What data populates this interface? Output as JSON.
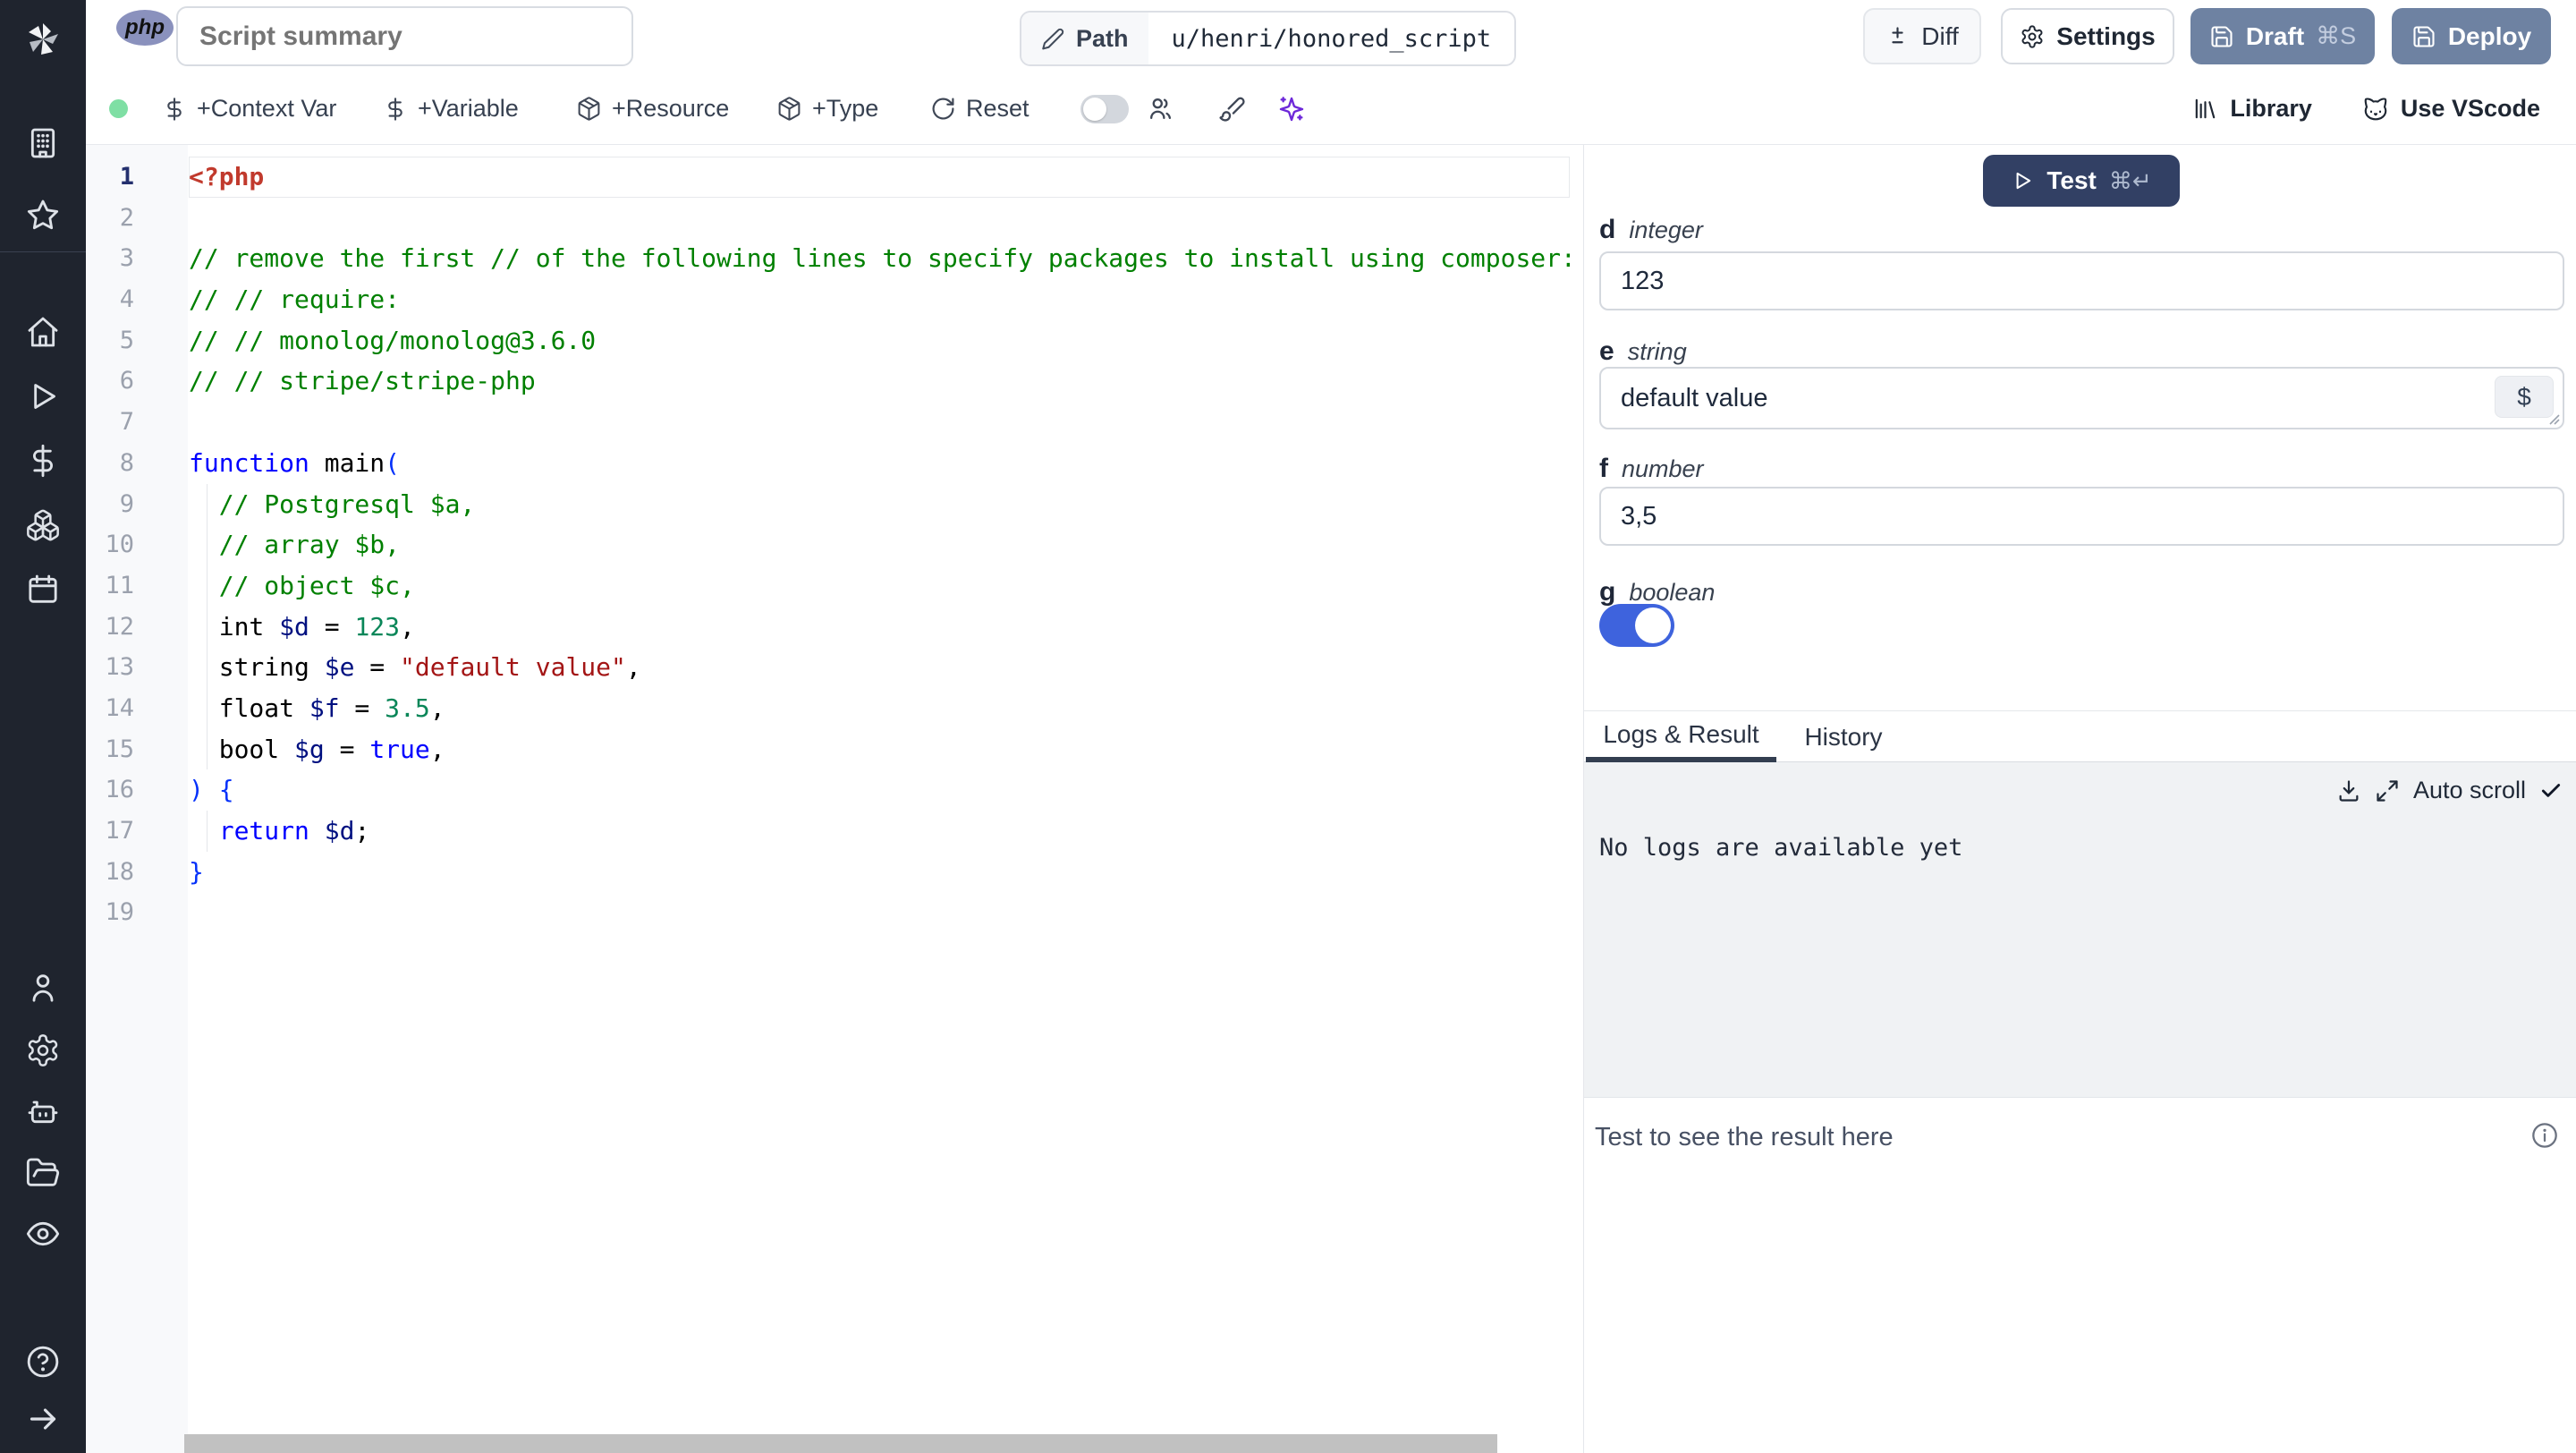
{
  "topbar": {
    "language_badge": "php",
    "summary_input": {
      "placeholder": "Script summary"
    },
    "path": {
      "label": "Path",
      "value": "u/henri/honored_script"
    },
    "diff_label": "Diff",
    "settings_label": "Settings",
    "draft": {
      "label": "Draft",
      "shortcut": "⌘S"
    },
    "deploy": {
      "label": "Deploy"
    }
  },
  "toolbar": {
    "status_color": "#7fdfa4",
    "add_context_var": "+Context Var",
    "add_variable": "+Variable",
    "add_resource": "+Resource",
    "add_type": "+Type",
    "reset": "Reset",
    "library": "Library",
    "use_vscode": "Use VScode"
  },
  "sidebar": {
    "icons": [
      "windmill-logo",
      "building",
      "star",
      "home",
      "play",
      "dollar",
      "boxes",
      "calendar",
      "user",
      "settings-gear",
      "worker-robot",
      "folder-open",
      "eye",
      "help-circle",
      "arrow-right"
    ]
  },
  "editor": {
    "colors": {
      "meta": "#c13a2d",
      "comment": "#008000",
      "keyword": "#0000ff",
      "variable": "#001080",
      "number": "#098658",
      "string": "#a31515",
      "bracket": "#0431fa"
    },
    "lines": [
      {
        "n": 1,
        "active": true,
        "tokens": [
          [
            "meta",
            "<?php"
          ]
        ]
      },
      {
        "n": 2,
        "tokens": []
      },
      {
        "n": 3,
        "tokens": [
          [
            "comment",
            "// remove the first // of the following lines to specify packages to install using composer:"
          ]
        ]
      },
      {
        "n": 4,
        "tokens": [
          [
            "comment",
            "// // require:"
          ]
        ]
      },
      {
        "n": 5,
        "tokens": [
          [
            "comment",
            "// // monolog/monolog@3.6.0"
          ]
        ]
      },
      {
        "n": 6,
        "tokens": [
          [
            "comment",
            "// // stripe/stripe-php"
          ]
        ]
      },
      {
        "n": 7,
        "tokens": []
      },
      {
        "n": 8,
        "tokens": [
          [
            "keyword",
            "function"
          ],
          [
            "plain",
            " main"
          ],
          [
            "bracket",
            "("
          ]
        ]
      },
      {
        "n": 9,
        "guide": true,
        "tokens": [
          [
            "comment",
            "  // Postgresql $a,"
          ]
        ]
      },
      {
        "n": 10,
        "guide": true,
        "tokens": [
          [
            "comment",
            "  // array $b,"
          ]
        ]
      },
      {
        "n": 11,
        "guide": true,
        "tokens": [
          [
            "comment",
            "  // object $c,"
          ]
        ]
      },
      {
        "n": 12,
        "guide": true,
        "tokens": [
          [
            "plain",
            "  int "
          ],
          [
            "variable",
            "$d"
          ],
          [
            "plain",
            " = "
          ],
          [
            "number",
            "123"
          ],
          [
            "plain",
            ","
          ]
        ]
      },
      {
        "n": 13,
        "guide": true,
        "tokens": [
          [
            "plain",
            "  string "
          ],
          [
            "variable",
            "$e"
          ],
          [
            "plain",
            " = "
          ],
          [
            "string",
            "\"default value\""
          ],
          [
            "plain",
            ","
          ]
        ]
      },
      {
        "n": 14,
        "guide": true,
        "tokens": [
          [
            "plain",
            "  float "
          ],
          [
            "variable",
            "$f"
          ],
          [
            "plain",
            " = "
          ],
          [
            "number",
            "3.5"
          ],
          [
            "plain",
            ","
          ]
        ]
      },
      {
        "n": 15,
        "guide": true,
        "tokens": [
          [
            "plain",
            "  bool "
          ],
          [
            "variable",
            "$g"
          ],
          [
            "plain",
            " = "
          ],
          [
            "keyword",
            "true"
          ],
          [
            "plain",
            ","
          ]
        ]
      },
      {
        "n": 16,
        "tokens": [
          [
            "bracket",
            ") {"
          ]
        ]
      },
      {
        "n": 17,
        "guide": true,
        "tokens": [
          [
            "plain",
            "  "
          ],
          [
            "keyword",
            "return"
          ],
          [
            "plain",
            " "
          ],
          [
            "variable",
            "$d"
          ],
          [
            "plain",
            ";"
          ]
        ]
      },
      {
        "n": 18,
        "tokens": [
          [
            "bracket",
            "}"
          ]
        ]
      },
      {
        "n": 19,
        "tokens": []
      }
    ]
  },
  "right_panel": {
    "test_button": {
      "label": "Test",
      "shortcut": "⌘↵"
    },
    "fields": [
      {
        "name": "d",
        "type": "integer",
        "value": "123"
      },
      {
        "name": "e",
        "type": "string",
        "value": "default value",
        "var_button": "$"
      },
      {
        "name": "f",
        "type": "number",
        "value": "3,5"
      },
      {
        "name": "g",
        "type": "boolean",
        "value": "true"
      }
    ],
    "tabs": [
      {
        "label": "Logs & Result",
        "active": true
      },
      {
        "label": "History",
        "active": false
      }
    ],
    "logs": {
      "auto_scroll_label": "Auto scroll",
      "empty_message": "No logs are available yet"
    },
    "result": {
      "empty_message": "Test to see the result here"
    }
  }
}
